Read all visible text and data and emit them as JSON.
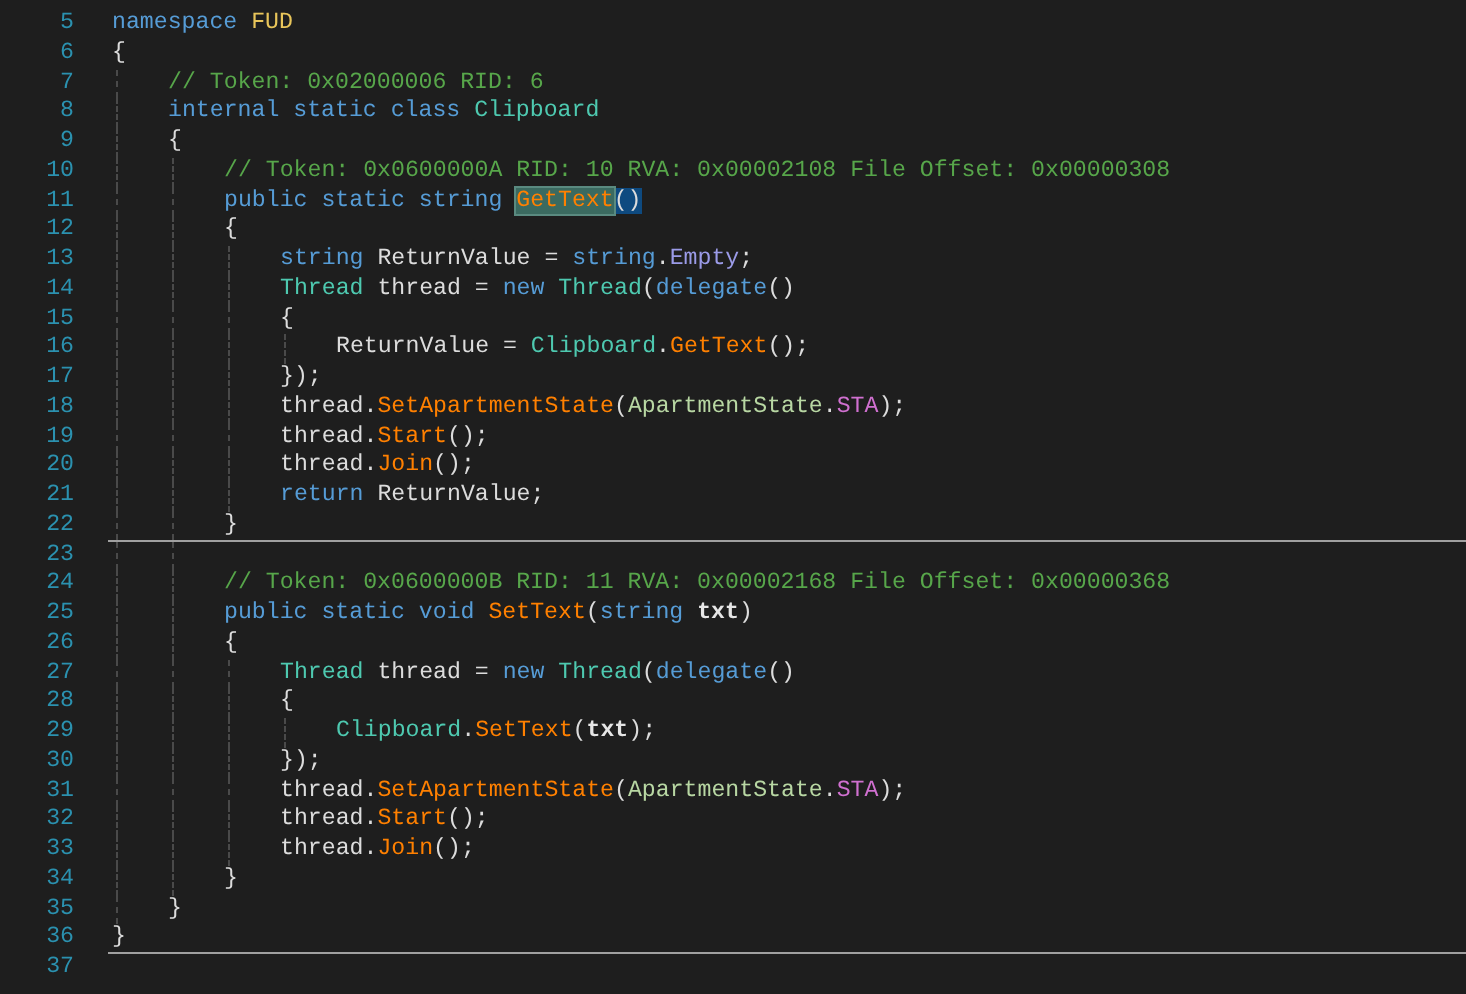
{
  "editor": {
    "lines": [
      {
        "number": "5",
        "tokens": [
          {
            "text": "namespace ",
            "kind": "keyword"
          },
          {
            "text": "FUD",
            "kind": "namespace"
          }
        ]
      },
      {
        "number": "6",
        "tokens": [
          {
            "text": "{",
            "kind": "plain"
          }
        ],
        "children": [
          {
            "number": "7",
            "tokens": [
              {
                "text": "// Token: 0x02000006 RID: 6",
                "kind": "comment"
              }
            ]
          },
          {
            "number": "8",
            "tokens": [
              {
                "text": "internal static class ",
                "kind": "keyword"
              },
              {
                "text": "Clipboard",
                "kind": "type"
              }
            ]
          },
          {
            "number": "9",
            "tokens": [
              {
                "text": "{",
                "kind": "plain"
              }
            ],
            "children": [
              {
                "number": "10",
                "tokens": [
                  {
                    "text": "// Token: 0x0600000A RID: 10 RVA: 0x00002108 File Offset: 0x00000308",
                    "kind": "comment"
                  }
                ]
              },
              {
                "number": "11",
                "tokens": [
                  {
                    "text": "public static string ",
                    "kind": "keyword"
                  },
                  {
                    "text": "GetText",
                    "kind": "method",
                    "selected": true
                  },
                  {
                    "text": "()",
                    "kind": "plain",
                    "brace_match": true
                  }
                ]
              },
              {
                "number": "12",
                "tokens": [
                  {
                    "text": "{",
                    "kind": "plain"
                  }
                ],
                "children": [
                  {
                    "number": "13",
                    "tokens": [
                      {
                        "text": "string ",
                        "kind": "keyword"
                      },
                      {
                        "text": "ReturnValue = ",
                        "kind": "plain"
                      },
                      {
                        "text": "string",
                        "kind": "keyword"
                      },
                      {
                        "text": ".",
                        "kind": "plain"
                      },
                      {
                        "text": "Empty",
                        "kind": "field"
                      },
                      {
                        "text": ";",
                        "kind": "plain"
                      }
                    ]
                  },
                  {
                    "number": "14",
                    "tokens": [
                      {
                        "text": "Thread",
                        "kind": "type"
                      },
                      {
                        "text": " thread = ",
                        "kind": "plain"
                      },
                      {
                        "text": "new ",
                        "kind": "keyword"
                      },
                      {
                        "text": "Thread",
                        "kind": "type"
                      },
                      {
                        "text": "(",
                        "kind": "plain"
                      },
                      {
                        "text": "delegate",
                        "kind": "keyword"
                      },
                      {
                        "text": "()",
                        "kind": "plain"
                      }
                    ]
                  },
                  {
                    "number": "15",
                    "tokens": [
                      {
                        "text": "{",
                        "kind": "plain"
                      }
                    ],
                    "children": [
                      {
                        "number": "16",
                        "tokens": [
                          {
                            "text": "ReturnValue = ",
                            "kind": "plain"
                          },
                          {
                            "text": "Clipboard",
                            "kind": "type"
                          },
                          {
                            "text": ".",
                            "kind": "plain"
                          },
                          {
                            "text": "GetText",
                            "kind": "method"
                          },
                          {
                            "text": "();",
                            "kind": "plain"
                          }
                        ]
                      }
                    ]
                  },
                  {
                    "number": "17",
                    "tokens": [
                      {
                        "text": "});",
                        "kind": "plain"
                      }
                    ]
                  },
                  {
                    "number": "18",
                    "tokens": [
                      {
                        "text": "thread.",
                        "kind": "plain"
                      },
                      {
                        "text": "SetApartmentState",
                        "kind": "method"
                      },
                      {
                        "text": "(",
                        "kind": "plain"
                      },
                      {
                        "text": "ApartmentState",
                        "kind": "enum"
                      },
                      {
                        "text": ".",
                        "kind": "plain"
                      },
                      {
                        "text": "STA",
                        "kind": "enum-value"
                      },
                      {
                        "text": ");",
                        "kind": "plain"
                      }
                    ]
                  },
                  {
                    "number": "19",
                    "tokens": [
                      {
                        "text": "thread.",
                        "kind": "plain"
                      },
                      {
                        "text": "Start",
                        "kind": "method"
                      },
                      {
                        "text": "();",
                        "kind": "plain"
                      }
                    ]
                  },
                  {
                    "number": "20",
                    "tokens": [
                      {
                        "text": "thread.",
                        "kind": "plain"
                      },
                      {
                        "text": "Join",
                        "kind": "method"
                      },
                      {
                        "text": "();",
                        "kind": "plain"
                      }
                    ]
                  },
                  {
                    "number": "21",
                    "tokens": [
                      {
                        "text": "return ",
                        "kind": "keyword"
                      },
                      {
                        "text": "ReturnValue;",
                        "kind": "plain"
                      }
                    ]
                  }
                ]
              },
              {
                "number": "22",
                "separator": true,
                "tokens": [
                  {
                    "text": "}",
                    "kind": "plain"
                  }
                ]
              },
              {
                "number": "23"
              },
              {
                "number": "24",
                "tokens": [
                  {
                    "text": "// Token: 0x0600000B RID: 11 RVA: 0x00002168 File Offset: 0x00000368",
                    "kind": "comment"
                  }
                ]
              },
              {
                "number": "25",
                "tokens": [
                  {
                    "text": "public static void ",
                    "kind": "keyword"
                  },
                  {
                    "text": "SetText",
                    "kind": "method"
                  },
                  {
                    "text": "(",
                    "kind": "plain"
                  },
                  {
                    "text": "string ",
                    "kind": "keyword"
                  },
                  {
                    "text": "txt",
                    "kind": "parameter"
                  },
                  {
                    "text": ")",
                    "kind": "plain"
                  }
                ]
              },
              {
                "number": "26",
                "tokens": [
                  {
                    "text": "{",
                    "kind": "plain"
                  }
                ],
                "children": [
                  {
                    "number": "27",
                    "tokens": [
                      {
                        "text": "Thread",
                        "kind": "type"
                      },
                      {
                        "text": " thread = ",
                        "kind": "plain"
                      },
                      {
                        "text": "new ",
                        "kind": "keyword"
                      },
                      {
                        "text": "Thread",
                        "kind": "type"
                      },
                      {
                        "text": "(",
                        "kind": "plain"
                      },
                      {
                        "text": "delegate",
                        "kind": "keyword"
                      },
                      {
                        "text": "()",
                        "kind": "plain"
                      }
                    ]
                  },
                  {
                    "number": "28",
                    "tokens": [
                      {
                        "text": "{",
                        "kind": "plain"
                      }
                    ],
                    "children": [
                      {
                        "number": "29",
                        "tokens": [
                          {
                            "text": "Clipboard",
                            "kind": "type"
                          },
                          {
                            "text": ".",
                            "kind": "plain"
                          },
                          {
                            "text": "SetText",
                            "kind": "method"
                          },
                          {
                            "text": "(",
                            "kind": "plain"
                          },
                          {
                            "text": "txt",
                            "kind": "parameter"
                          },
                          {
                            "text": ");",
                            "kind": "plain"
                          }
                        ]
                      }
                    ]
                  },
                  {
                    "number": "30",
                    "tokens": [
                      {
                        "text": "});",
                        "kind": "plain"
                      }
                    ]
                  },
                  {
                    "number": "31",
                    "tokens": [
                      {
                        "text": "thread.",
                        "kind": "plain"
                      },
                      {
                        "text": "SetApartmentState",
                        "kind": "method"
                      },
                      {
                        "text": "(",
                        "kind": "plain"
                      },
                      {
                        "text": "ApartmentState",
                        "kind": "enum"
                      },
                      {
                        "text": ".",
                        "kind": "plain"
                      },
                      {
                        "text": "STA",
                        "kind": "enum-value"
                      },
                      {
                        "text": ");",
                        "kind": "plain"
                      }
                    ]
                  },
                  {
                    "number": "32",
                    "tokens": [
                      {
                        "text": "thread.",
                        "kind": "plain"
                      },
                      {
                        "text": "Start",
                        "kind": "method"
                      },
                      {
                        "text": "();",
                        "kind": "plain"
                      }
                    ]
                  },
                  {
                    "number": "33",
                    "tokens": [
                      {
                        "text": "thread.",
                        "kind": "plain"
                      },
                      {
                        "text": "Join",
                        "kind": "method"
                      },
                      {
                        "text": "();",
                        "kind": "plain"
                      }
                    ]
                  }
                ]
              },
              {
                "number": "34",
                "tokens": [
                  {
                    "text": "}",
                    "kind": "plain"
                  }
                ]
              }
            ]
          },
          {
            "number": "35",
            "tokens": [
              {
                "text": "}",
                "kind": "plain"
              }
            ]
          }
        ]
      },
      {
        "number": "36",
        "separator": true,
        "tokens": [
          {
            "text": "}",
            "kind": "plain"
          }
        ]
      },
      {
        "number": "37"
      }
    ]
  }
}
